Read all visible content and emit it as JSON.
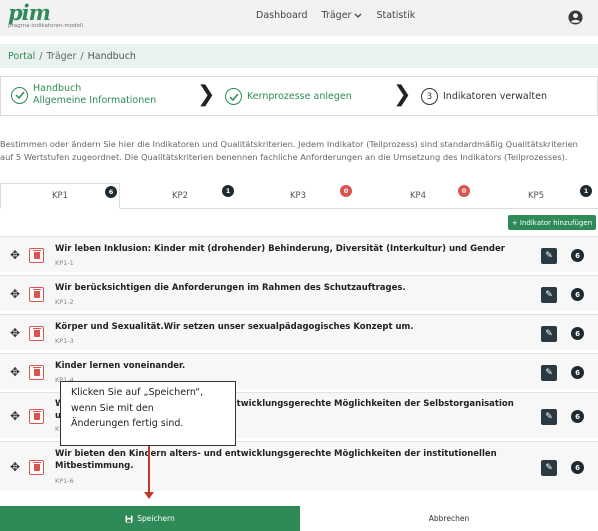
{
  "brand": {
    "name": "pim",
    "tagline": "pragma-indikatoren-modell"
  },
  "nav": {
    "dashboard": "Dashboard",
    "traeger": "Träger",
    "statistik": "Statistik"
  },
  "breadcrumb": {
    "portal": "Portal",
    "traeger": "Träger",
    "current": "Handbuch"
  },
  "wizard": {
    "step1_line1": "Handbuch",
    "step1_line2": "Allgemeine Informationen",
    "step2": "Kernprozesse anlegen",
    "step3_num": "3",
    "step3": "Indikatoren verwalten"
  },
  "description": "Bestimmen oder ändern Sie hier die Indikatoren und Qualitätskriterien. Jedem Indikator (Teilprozess) sind standardmäßig Qualitätskriterien auf 5 Wertstufen zugeordnet. Die Qualitätskriterien benennen fachliche Anforderungen an die Umsetzung des Indikators (Teilprozesses).",
  "tabs": [
    {
      "label": "KP1",
      "badge": "6",
      "badge_color": "#1f2a30"
    },
    {
      "label": "KP2",
      "badge": "1",
      "badge_color": "#1f2a30"
    },
    {
      "label": "KP3",
      "badge": "0",
      "badge_color": "#d9534f"
    },
    {
      "label": "KP4",
      "badge": "0",
      "badge_color": "#d9534f"
    },
    {
      "label": "KP5",
      "badge": "1",
      "badge_color": "#1f2a30"
    }
  ],
  "add_button": "+ Indikator hinzufügen",
  "rows": [
    {
      "title": "Wir leben Inklusion: Kinder mit (drohender) Behinderung, Diversität (Interkultur) und Gender",
      "code": "KP1-1",
      "count": "6"
    },
    {
      "title": "Wir berücksichtigen die Anforderungen im Rahmen des Schutzauftrages.",
      "code": "KP1-2",
      "count": "6"
    },
    {
      "title": "Körper und Sexualität.Wir setzen unser sexualpädagogisches Konzept um.",
      "code": "KP1-3",
      "count": "6"
    },
    {
      "title": "Kinder lernen voneinander.",
      "code": "KP1-4",
      "count": "6"
    },
    {
      "title": "Wir bieten den Kindern alters- und entwicklungsgerechte Möglichkeiten der Selbstorganisation und Selbstbestimmung.",
      "code": "KP1-5",
      "count": "6"
    },
    {
      "title": "Wir bieten den Kindern alters- und entwicklungsgerechte Möglichkeiten der institutionellen Mitbestimmung.",
      "code": "KP1-6",
      "count": "6"
    }
  ],
  "tooltip": {
    "line1": "Klicken Sie auf „Speichern“,",
    "line2": "wenn Sie mit den",
    "line3": "Änderungen fertig sind."
  },
  "footer": {
    "save": "Speichern",
    "cancel": "Abbrechen"
  },
  "colors": {
    "accent": "#2e8b57",
    "danger": "#d9534f",
    "dark": "#1f2a30"
  }
}
